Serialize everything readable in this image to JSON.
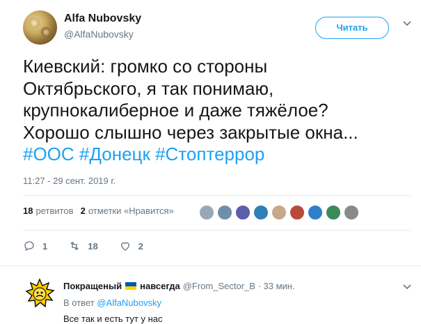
{
  "tweet": {
    "author": {
      "display_name": "Alfa Nubovsky",
      "handle": "@AlfaNubovsky"
    },
    "follow_label": "Читать",
    "text_lines": [
      "Киевский: громко со стороны",
      "Октябрьского, я так понимаю,",
      "крупнокалиберное и даже тяжёлое?",
      "Хорошо слышно через закрытые окна..."
    ],
    "hashtags": [
      "#ООС",
      "#Донецк",
      "#Стоптеррор"
    ],
    "timestamp": "11:27 - 29 сент. 2019 г.",
    "stats": {
      "retweets_count": "18",
      "retweets_label": "ретвитов",
      "likes_count": "2",
      "likes_label": "отметки «Нравится»"
    },
    "likers": [
      {
        "color": "#9aa7b4"
      },
      {
        "color": "#6f8fa8"
      },
      {
        "color": "#5b5ea8"
      },
      {
        "color": "#2f7fb8"
      },
      {
        "color": "#c8a78a"
      },
      {
        "color": "#b84a3a"
      },
      {
        "color": "#2f7fc8"
      },
      {
        "color": "#3a8a5a"
      },
      {
        "color": "#8a8a8a"
      }
    ],
    "actions": {
      "replies": "1",
      "retweets": "18",
      "likes": "2"
    }
  },
  "reply": {
    "display_name": "Покращеный",
    "name_suffix": "навсегда",
    "handle": "@From_Sector_B",
    "time": "33 мин.",
    "reply_prefix": "В ответ",
    "reply_mention": "@AlfaNubovsky",
    "text": "Все так и есть тут у нас"
  },
  "colors": {
    "accent": "#1da1f2",
    "secondary_text": "#657786",
    "primary_text": "#14171a",
    "divider": "#e6ecf0"
  }
}
